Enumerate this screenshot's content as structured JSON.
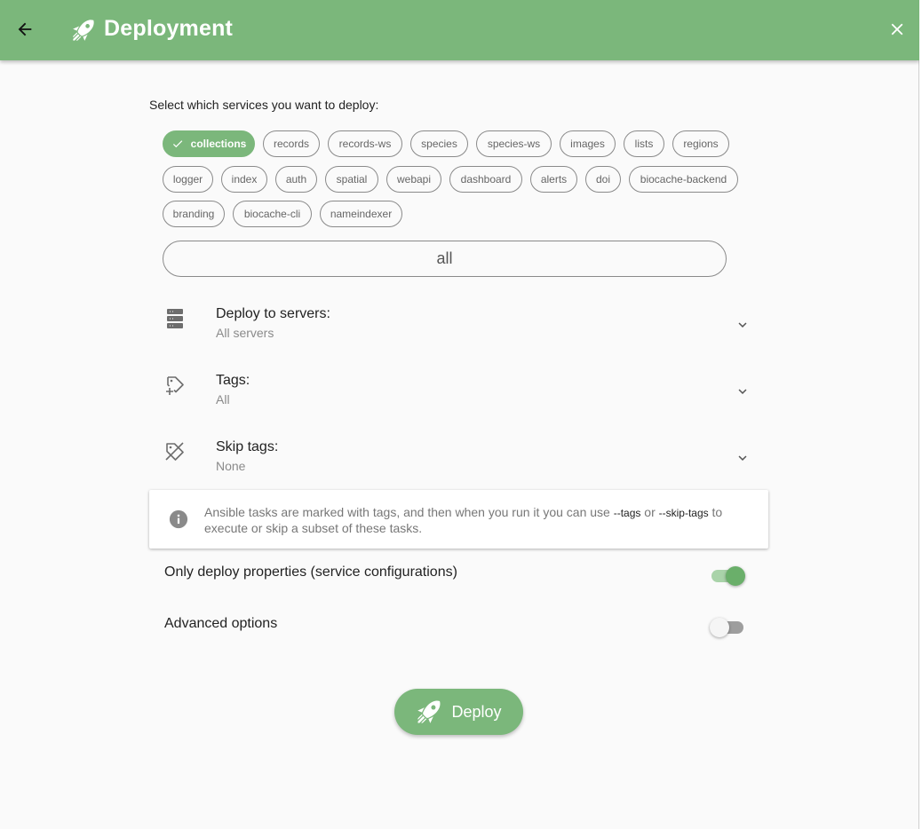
{
  "header": {
    "title": "Deployment",
    "back_icon": "arrow-left-icon",
    "title_icon": "rocket-icon",
    "close_icon": "close-icon"
  },
  "prompt": "Select which services you want to deploy:",
  "services": [
    {
      "label": "collections",
      "selected": true
    },
    {
      "label": "records",
      "selected": false
    },
    {
      "label": "records-ws",
      "selected": false
    },
    {
      "label": "species",
      "selected": false
    },
    {
      "label": "species-ws",
      "selected": false
    },
    {
      "label": "images",
      "selected": false
    },
    {
      "label": "lists",
      "selected": false
    },
    {
      "label": "regions",
      "selected": false
    },
    {
      "label": "logger",
      "selected": false
    },
    {
      "label": "index",
      "selected": false
    },
    {
      "label": "auth",
      "selected": false
    },
    {
      "label": "spatial",
      "selected": false
    },
    {
      "label": "webapi",
      "selected": false
    },
    {
      "label": "dashboard",
      "selected": false
    },
    {
      "label": "alerts",
      "selected": false
    },
    {
      "label": "doi",
      "selected": false
    },
    {
      "label": "biocache-backend",
      "selected": false
    },
    {
      "label": "branding",
      "selected": false
    },
    {
      "label": "biocache-cli",
      "selected": false
    },
    {
      "label": "nameindexer",
      "selected": false
    }
  ],
  "all_label": "all",
  "selects": {
    "servers": {
      "label": "Deploy to servers:",
      "value": "All servers",
      "icon": "server-icon"
    },
    "tags": {
      "label": "Tags:",
      "value": "All",
      "icon": "tag-plus-icon"
    },
    "skip_tags": {
      "label": "Skip tags:",
      "value": "None",
      "icon": "tag-off-icon"
    }
  },
  "info": {
    "icon": "info-icon",
    "text_1": "Ansible tasks are marked with tags, and then when you run it you can use ",
    "code_1": "--tags",
    "text_2": " or ",
    "code_2": "--skip-tags",
    "text_3": " to execute or skip a subset of these tasks."
  },
  "toggles": {
    "only_properties": {
      "label": "Only deploy properties (service configurations)",
      "on": true
    },
    "advanced": {
      "label": "Advanced options",
      "on": false
    }
  },
  "deploy_button": {
    "label": "Deploy",
    "icon": "rocket-icon"
  },
  "colors": {
    "accent": "#7bb77b",
    "switch_on": "#6aaf6a",
    "background": "#fafafa"
  }
}
